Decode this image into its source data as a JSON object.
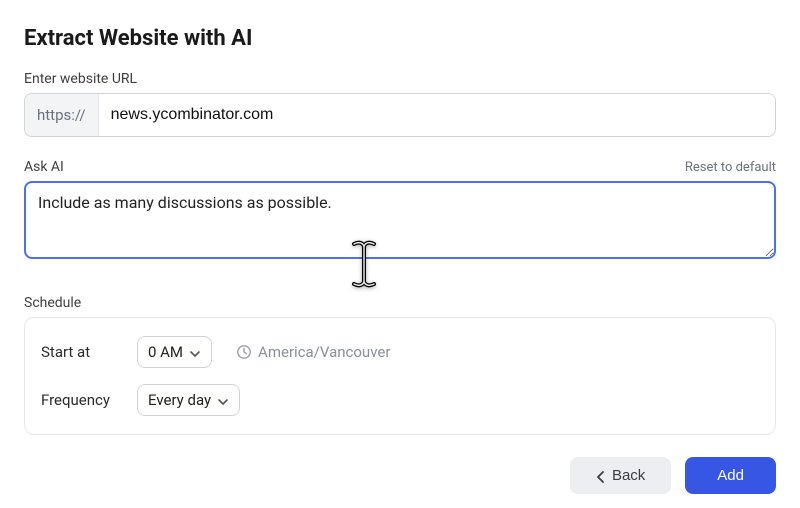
{
  "title": "Extract Website with AI",
  "url": {
    "label": "Enter website URL",
    "prefix": "https://",
    "value": "news.ycombinator.com"
  },
  "ai": {
    "label": "Ask AI",
    "reset": "Reset to default",
    "value": "Include as many discussions as possible."
  },
  "schedule": {
    "label": "Schedule",
    "start_label": "Start at",
    "start_value": "0 AM",
    "timezone": "America/Vancouver",
    "freq_label": "Frequency",
    "freq_value": "Every day"
  },
  "footer": {
    "back": "Back",
    "add": "Add"
  }
}
